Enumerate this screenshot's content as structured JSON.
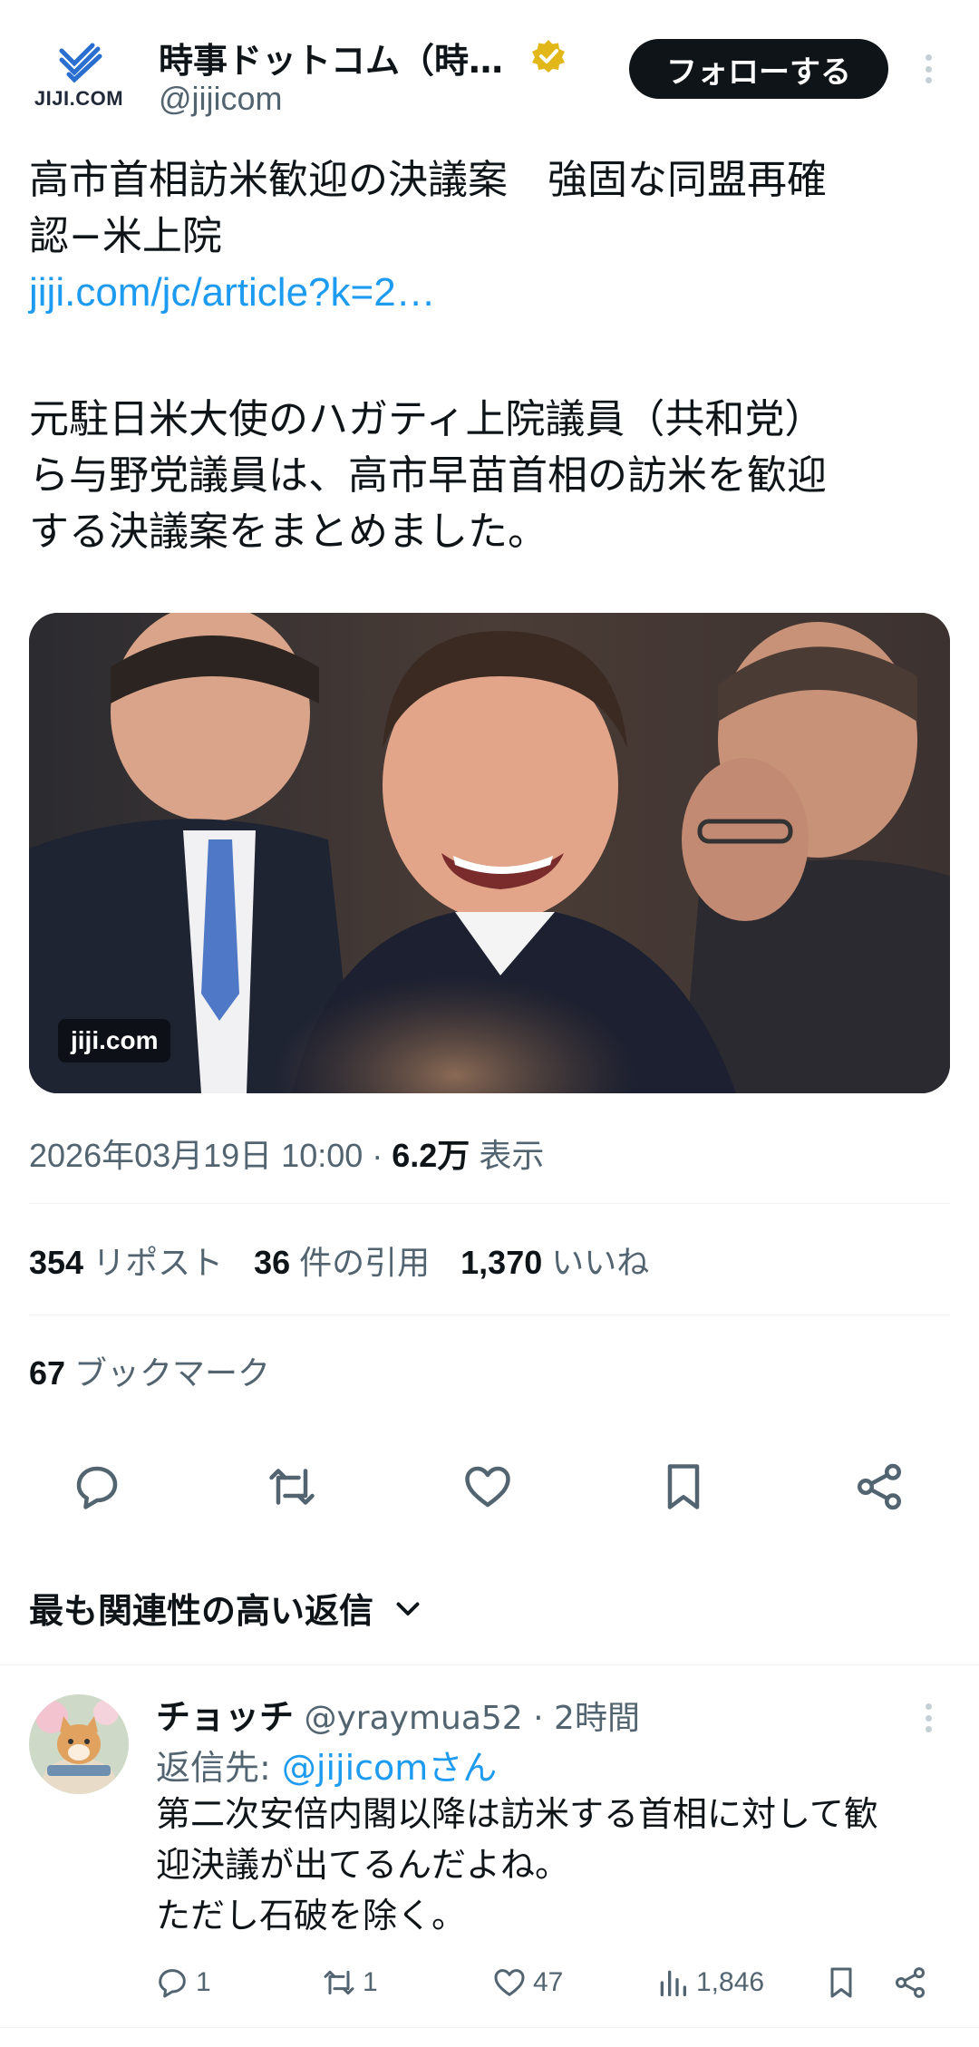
{
  "author": {
    "logo_text": "JIJI.COM",
    "display_name": "時事ドットコム（時…",
    "handle": "@jijicom",
    "follow_label": "フォローする"
  },
  "tweet": {
    "headline_line1": "高市首相訪米歓迎の決議案　強固な同盟再確",
    "headline_line2": "認−米上院",
    "link": "jiji.com/jc/article?k=2…",
    "body_line1": "元駐日米大使のハガティ上院議員（共和党）",
    "body_line2": "ら与野党議員は、高市早苗首相の訪米を歓迎",
    "body_line3": "する決議案をまとめました。",
    "media_label": "jiji.com",
    "timestamp": "2026年03月19日 10:00 · ",
    "views_count": "6.2万",
    "views_label": " 表示"
  },
  "stats": {
    "reposts_count": "354",
    "reposts_label": "リポスト",
    "quotes_count": "36",
    "quotes_label": "件の引用",
    "likes_count": "1,370",
    "likes_label": "いいね",
    "bookmarks_count": "67",
    "bookmarks_label": "ブックマーク"
  },
  "actions": {
    "icons": [
      "reply-icon",
      "repost-icon",
      "like-icon",
      "bookmark-icon",
      "share-icon"
    ]
  },
  "replies_sort": {
    "label": "最も関連性の高い返信"
  },
  "reply": {
    "name": "チョッチ",
    "handle": "@yraymua52",
    "time": " · 2時間",
    "reply_to_prefix": "返信先: ",
    "reply_to_mention": "@jijicomさん",
    "text_line1": "第二次安倍内閣以降は訪米する首相に対して歓",
    "text_line2": "迎決議が出てるんだよね。",
    "text_line3": "ただし石破を除く。",
    "replies": "1",
    "reposts": "1",
    "likes": "47",
    "views": "1,846"
  },
  "colors": {
    "link": "#1d9bf0",
    "secondary_text": "#536471",
    "primary_text": "#0f1419",
    "verified_badge": "#e2b719"
  }
}
